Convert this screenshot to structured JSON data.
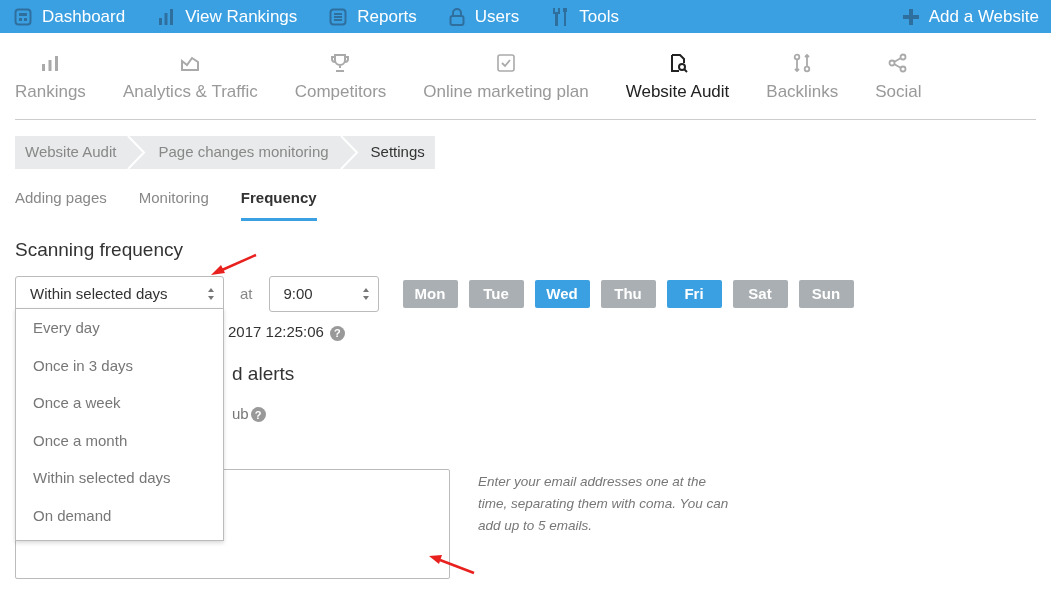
{
  "top_nav": {
    "items": [
      {
        "label": "Dashboard"
      },
      {
        "label": "View Rankings"
      },
      {
        "label": "Reports"
      },
      {
        "label": "Users"
      },
      {
        "label": "Tools"
      }
    ],
    "action": "Add a Website"
  },
  "module_tabs": [
    {
      "label": "Rankings",
      "selected": false
    },
    {
      "label": "Analytics & Traffic",
      "selected": false
    },
    {
      "label": "Competitors",
      "selected": false
    },
    {
      "label": "Online marketing plan",
      "selected": false
    },
    {
      "label": "Website Audit",
      "selected": true
    },
    {
      "label": "Backlinks",
      "selected": false
    },
    {
      "label": "Social",
      "selected": false
    }
  ],
  "breadcrumb": [
    {
      "label": "Website Audit",
      "selected": false
    },
    {
      "label": "Page changes monitoring",
      "selected": false
    },
    {
      "label": "Settings",
      "selected": true
    }
  ],
  "sub_tabs": [
    {
      "label": "Adding pages",
      "selected": false
    },
    {
      "label": "Monitoring",
      "selected": false
    },
    {
      "label": "Frequency",
      "selected": true
    }
  ],
  "section_title": "Scanning frequency",
  "frequency_select": {
    "value": "Within selected days",
    "expanded": true,
    "options": [
      "Every day",
      "Once in 3 days",
      "Once a week",
      "Once a month",
      "Within selected days",
      "On demand"
    ]
  },
  "at_label": "at",
  "time_select": {
    "value": "9:00"
  },
  "days": [
    {
      "label": "Mon",
      "selected": false
    },
    {
      "label": "Tue",
      "selected": false
    },
    {
      "label": "Wed",
      "selected": true
    },
    {
      "label": "Thu",
      "selected": false
    },
    {
      "label": "Fri",
      "selected": true
    },
    {
      "label": "Sat",
      "selected": false
    },
    {
      "label": "Sun",
      "selected": false
    }
  ],
  "next_scan": {
    "text": "2017 12:25:06",
    "help": "?"
  },
  "alerts_title": "d alerts",
  "hub_label": {
    "text": "ub",
    "help": "?"
  },
  "emails": {
    "hint": "Enter your email addresses one at the time, separating them with coma. You can add up to 5 emails."
  }
}
